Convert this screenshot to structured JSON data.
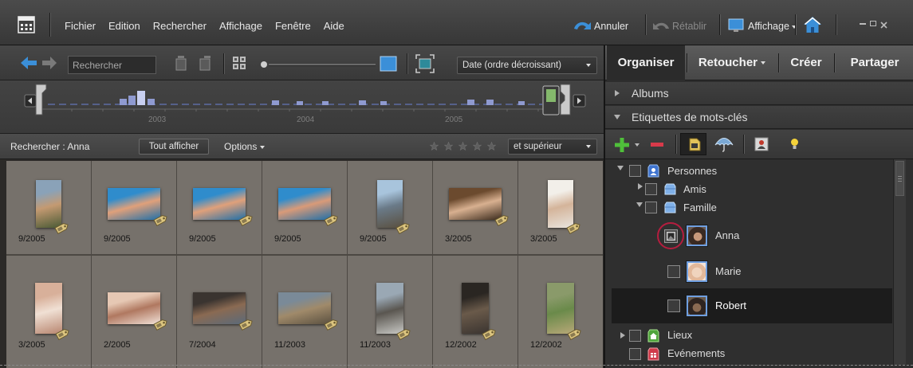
{
  "menu": {
    "items": [
      "Fichier",
      "Edition",
      "Rechercher",
      "Affichage",
      "Fenêtre",
      "Aide"
    ],
    "undo": "Annuler",
    "redo": "Rétablir",
    "display": "Affichage"
  },
  "toolbar": {
    "search_placeholder": "Rechercher",
    "sort": "Date (ordre décroissant)"
  },
  "timeline": {
    "years": [
      "2003",
      "2004",
      "2005"
    ]
  },
  "searchbar": {
    "label": "Rechercher : Anna",
    "show_all": "Tout afficher",
    "options": "Options",
    "rating_filter": "et supérieur",
    "stars": 5
  },
  "tabs": {
    "organise": "Organiser",
    "retouch": "Retoucher",
    "create": "Créer",
    "share": "Partager"
  },
  "panel": {
    "albums": "Albums",
    "keywords": "Etiquettes de mots-clés"
  },
  "tree": {
    "persons": "Personnes",
    "friends": "Amis",
    "family": "Famille",
    "anna": "Anna",
    "marie": "Marie",
    "robert": "Robert",
    "places": "Lieux",
    "events": "Evénements"
  },
  "colors": {
    "accent": "#3b8fd8",
    "add": "#4fbf3a",
    "remove": "#d83a4a",
    "highlight_circle": "#b51d3f"
  },
  "photos": [
    {
      "date": "9/2005",
      "portrait": true,
      "colors": [
        "#8aa2b8",
        "#c49a72",
        "#4a5a35"
      ]
    },
    {
      "date": "9/2005",
      "portrait": false,
      "colors": [
        "#2f8ccc",
        "#e0a07a",
        "#1f6fa8"
      ]
    },
    {
      "date": "9/2005",
      "portrait": false,
      "colors": [
        "#2f8ccc",
        "#e0a07a",
        "#1f6fa8"
      ]
    },
    {
      "date": "9/2005",
      "portrait": false,
      "colors": [
        "#2f8ccc",
        "#d99a78",
        "#1f6fa8"
      ]
    },
    {
      "date": "9/2005",
      "portrait": true,
      "colors": [
        "#a8c4dc",
        "#6a7a88",
        "#5a5040"
      ]
    },
    {
      "date": "3/2005",
      "portrait": false,
      "colors": [
        "#6b4a2e",
        "#d8b090",
        "#3a2a1c"
      ]
    },
    {
      "date": "3/2005",
      "portrait": true,
      "colors": [
        "#f2efe9",
        "#d4b49a",
        "#e8e4de"
      ]
    },
    {
      "date": "3/2005",
      "portrait": true,
      "colors": [
        "#d8b09a",
        "#f0e0d4",
        "#b88670"
      ]
    },
    {
      "date": "2/2005",
      "portrait": false,
      "colors": [
        "#e6c8b4",
        "#b07860",
        "#f2e2d8"
      ]
    },
    {
      "date": "7/2004",
      "portrait": false,
      "colors": [
        "#3a3430",
        "#8a6a52",
        "#5a6a7a"
      ]
    },
    {
      "date": "11/2003",
      "portrait": false,
      "colors": [
        "#7a8a98",
        "#a08a6a",
        "#5a5040"
      ]
    },
    {
      "date": "11/2003",
      "portrait": true,
      "colors": [
        "#9aa8b4",
        "#5a5650",
        "#c8c8c4"
      ]
    },
    {
      "date": "12/2002",
      "portrait": true,
      "colors": [
        "#2a2622",
        "#6a5a4a",
        "#3a3430"
      ]
    },
    {
      "date": "12/2002",
      "portrait": true,
      "colors": [
        "#8a9a6a",
        "#6a8a4a",
        "#b8a878"
      ]
    }
  ]
}
